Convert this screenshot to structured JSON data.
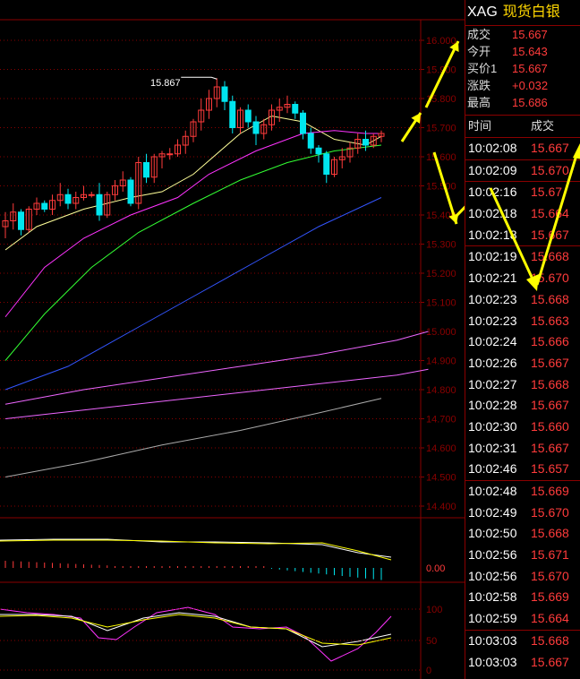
{
  "instrument": {
    "code": "XAG",
    "name": "现货白银"
  },
  "quote": [
    {
      "k": "成交",
      "v": "15.667"
    },
    {
      "k": "今开",
      "v": "15.643"
    },
    {
      "k": "买价1",
      "v": "15.667"
    },
    {
      "k": "涨跌",
      "v": "+0.032"
    },
    {
      "k": "最高",
      "v": "15.686"
    }
  ],
  "ticks_header": {
    "time": "时间",
    "price": "成交"
  },
  "ticks": [
    {
      "t": "10:02:08",
      "p": "15.667"
    },
    {
      "t": "10:02:09",
      "p": "15.670"
    },
    {
      "t": "10:02:16",
      "p": "15.67"
    },
    {
      "t": "10:02:18",
      "p": "15.664"
    },
    {
      "t": "10:02:18",
      "p": "15.667"
    },
    {
      "t": "10:02:19",
      "p": "15.668"
    },
    {
      "t": "10:02:21",
      "p": "15.670"
    },
    {
      "t": "10:02:23",
      "p": "15.668"
    },
    {
      "t": "10:02:23",
      "p": "15.663"
    },
    {
      "t": "10:02:24",
      "p": "15.666"
    },
    {
      "t": "10:02:26",
      "p": "15.667"
    },
    {
      "t": "10:02:27",
      "p": "15.668"
    },
    {
      "t": "10:02:28",
      "p": "15.667"
    },
    {
      "t": "10:02:30",
      "p": "15.660"
    },
    {
      "t": "10:02:31",
      "p": "15.667"
    },
    {
      "t": "10:02:46",
      "p": "15.657"
    },
    {
      "t": "10:02:48",
      "p": "15.669"
    },
    {
      "t": "10:02:49",
      "p": "15.670"
    },
    {
      "t": "10:02:50",
      "p": "15.668"
    },
    {
      "t": "10:02:56",
      "p": "15.671"
    },
    {
      "t": "10:02:56",
      "p": "15.670"
    },
    {
      "t": "10:02:58",
      "p": "15.669"
    },
    {
      "t": "10:02:59",
      "p": "15.664"
    },
    {
      "t": "10:03:03",
      "p": "15.668"
    },
    {
      "t": "10:03:03",
      "p": "15.667"
    }
  ],
  "colors": {
    "up": "#ff3b3b",
    "down": "#00e5ee",
    "grid": "#8a0000",
    "arrow": "#ffff00"
  },
  "chart_data": {
    "type": "candlestick",
    "ylim": [
      14.4,
      16.0
    ],
    "yticks": [
      "16.000",
      "15.900",
      "15.800",
      "15.700",
      "15.600",
      "15.500",
      "15.400",
      "15.300",
      "15.200",
      "15.100",
      "15.000",
      "14.900",
      "14.800",
      "14.700",
      "14.600",
      "14.500",
      "14.400"
    ],
    "annotation": {
      "label": "15.867",
      "value": 15.867
    },
    "candles": [
      [
        15.36,
        15.41,
        15.32,
        15.38
      ],
      [
        15.38,
        15.44,
        15.35,
        15.41
      ],
      [
        15.41,
        15.42,
        15.33,
        15.35
      ],
      [
        15.35,
        15.43,
        15.34,
        15.42
      ],
      [
        15.42,
        15.46,
        15.4,
        15.44
      ],
      [
        15.44,
        15.45,
        15.41,
        15.42
      ],
      [
        15.42,
        15.47,
        15.4,
        15.45
      ],
      [
        15.45,
        15.51,
        15.43,
        15.47
      ],
      [
        15.47,
        15.49,
        15.42,
        15.44
      ],
      [
        15.44,
        15.48,
        15.42,
        15.46
      ],
      [
        15.46,
        15.5,
        15.45,
        15.47
      ],
      [
        15.47,
        15.48,
        15.46,
        15.47
      ],
      [
        15.47,
        15.51,
        15.38,
        15.4
      ],
      [
        15.4,
        15.48,
        15.39,
        15.47
      ],
      [
        15.47,
        15.52,
        15.45,
        15.5
      ],
      [
        15.5,
        15.55,
        15.48,
        15.52
      ],
      [
        15.52,
        15.53,
        15.43,
        15.44
      ],
      [
        15.44,
        15.6,
        15.42,
        15.58
      ],
      [
        15.58,
        15.61,
        15.51,
        15.53
      ],
      [
        15.53,
        15.61,
        15.51,
        15.6
      ],
      [
        15.6,
        15.62,
        15.56,
        15.61
      ],
      [
        15.61,
        15.63,
        15.59,
        15.61
      ],
      [
        15.61,
        15.66,
        15.6,
        15.64
      ],
      [
        15.64,
        15.69,
        15.61,
        15.67
      ],
      [
        15.67,
        15.73,
        15.65,
        15.72
      ],
      [
        15.72,
        15.8,
        15.69,
        15.76
      ],
      [
        15.76,
        15.83,
        15.73,
        15.8
      ],
      [
        15.8,
        15.87,
        15.77,
        15.84
      ],
      [
        15.84,
        15.86,
        15.76,
        15.79
      ],
      [
        15.79,
        15.81,
        15.68,
        15.7
      ],
      [
        15.7,
        15.77,
        15.68,
        15.76
      ],
      [
        15.76,
        15.78,
        15.7,
        15.72
      ],
      [
        15.72,
        15.74,
        15.64,
        15.68
      ],
      [
        15.68,
        15.73,
        15.66,
        15.71
      ],
      [
        15.71,
        15.78,
        15.69,
        15.76
      ],
      [
        15.76,
        15.8,
        15.72,
        15.77
      ],
      [
        15.77,
        15.81,
        15.75,
        15.78
      ],
      [
        15.78,
        15.79,
        15.73,
        15.75
      ],
      [
        15.75,
        15.76,
        15.66,
        15.68
      ],
      [
        15.68,
        15.7,
        15.61,
        15.63
      ],
      [
        15.63,
        15.64,
        15.58,
        15.61
      ],
      [
        15.61,
        15.62,
        15.51,
        15.54
      ],
      [
        15.54,
        15.6,
        15.53,
        15.59
      ],
      [
        15.59,
        15.63,
        15.56,
        15.6
      ],
      [
        15.6,
        15.65,
        15.58,
        15.63
      ],
      [
        15.63,
        15.68,
        15.61,
        15.66
      ],
      [
        15.66,
        15.69,
        15.62,
        15.64
      ],
      [
        15.64,
        15.68,
        15.63,
        15.67
      ],
      [
        15.67,
        15.69,
        15.65,
        15.68
      ]
    ],
    "ma": [
      {
        "color": "#ffff99",
        "points": [
          [
            15.28,
            0
          ],
          [
            15.36,
            4
          ],
          [
            15.42,
            10
          ],
          [
            15.46,
            16
          ],
          [
            15.48,
            20
          ],
          [
            15.54,
            24
          ],
          [
            15.68,
            30
          ],
          [
            15.74,
            34
          ],
          [
            15.72,
            38
          ],
          [
            15.66,
            42
          ],
          [
            15.64,
            46
          ],
          [
            15.67,
            48
          ]
        ]
      },
      {
        "color": "#ff33ff",
        "points": [
          [
            15.05,
            0
          ],
          [
            15.22,
            5
          ],
          [
            15.32,
            10
          ],
          [
            15.4,
            16
          ],
          [
            15.46,
            22
          ],
          [
            15.54,
            26
          ],
          [
            15.62,
            32
          ],
          [
            15.68,
            38
          ],
          [
            15.69,
            42
          ],
          [
            15.68,
            46
          ],
          [
            15.68,
            48
          ]
        ]
      },
      {
        "color": "#33ff33",
        "points": [
          [
            14.9,
            0
          ],
          [
            15.06,
            5
          ],
          [
            15.22,
            11
          ],
          [
            15.34,
            17
          ],
          [
            15.44,
            24
          ],
          [
            15.52,
            30
          ],
          [
            15.58,
            36
          ],
          [
            15.62,
            42
          ],
          [
            15.64,
            48
          ]
        ]
      },
      {
        "color": "#3355ff",
        "points": [
          [
            14.8,
            0
          ],
          [
            14.88,
            8
          ],
          [
            15.0,
            16
          ],
          [
            15.12,
            24
          ],
          [
            15.24,
            32
          ],
          [
            15.36,
            40
          ],
          [
            15.46,
            48
          ]
        ]
      },
      {
        "color": "#ee66ff",
        "points": [
          [
            14.75,
            0
          ],
          [
            14.8,
            10
          ],
          [
            14.84,
            20
          ],
          [
            14.88,
            30
          ],
          [
            14.92,
            40
          ],
          [
            14.97,
            50
          ],
          [
            15.0,
            54
          ]
        ]
      },
      {
        "color": "#ee66ff",
        "points": [
          [
            14.7,
            0
          ],
          [
            14.73,
            10
          ],
          [
            14.76,
            20
          ],
          [
            14.79,
            30
          ],
          [
            14.82,
            40
          ],
          [
            14.85,
            50
          ],
          [
            14.87,
            54
          ]
        ]
      },
      {
        "color": "#aaaaaa",
        "points": [
          [
            14.5,
            0
          ],
          [
            14.55,
            10
          ],
          [
            14.61,
            20
          ],
          [
            14.66,
            30
          ],
          [
            14.72,
            40
          ],
          [
            14.77,
            48
          ]
        ]
      }
    ],
    "macd": {
      "zero_label": "0.00"
    },
    "kdj": {
      "ticks": [
        "100",
        "50",
        "0"
      ]
    }
  }
}
